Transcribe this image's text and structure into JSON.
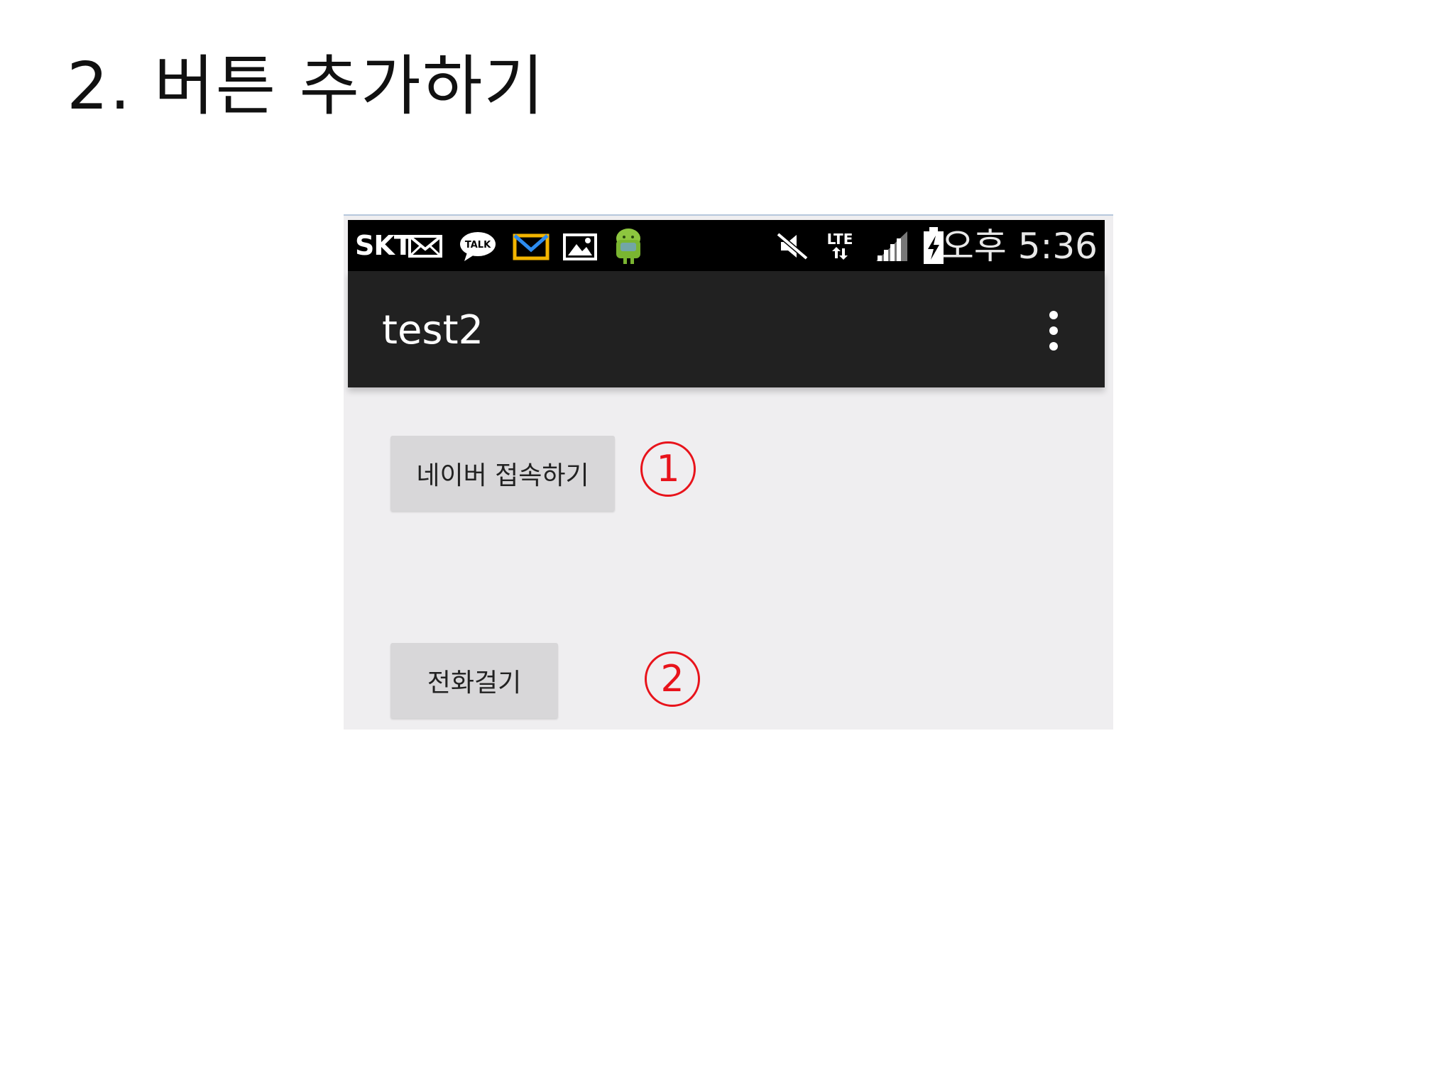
{
  "slide": {
    "title": "2. 버튼 추가하기"
  },
  "statusbar": {
    "carrier": "SKT",
    "icons": [
      "mail-icon",
      "kakaotalk-icon",
      "gmail-icon",
      "gallery-icon",
      "android-icon",
      "mute-icon",
      "lte-icon",
      "signal-icon",
      "battery-charging-icon"
    ],
    "lte_label": "LTE",
    "talk_label": "TALK",
    "time": "오후 5:36"
  },
  "appbar": {
    "title": "test2",
    "menu_icon": "overflow-menu-icon"
  },
  "buttons": {
    "naver_label": "네이버 접속하기",
    "call_label": "전화걸기"
  },
  "annotations": {
    "marker_1": "1",
    "marker_2": "2",
    "color": "#e8131b"
  },
  "colors": {
    "statusbar": "#000000",
    "appbar": "#212121",
    "background": "#efeef0",
    "button": "#d8d7d9"
  }
}
